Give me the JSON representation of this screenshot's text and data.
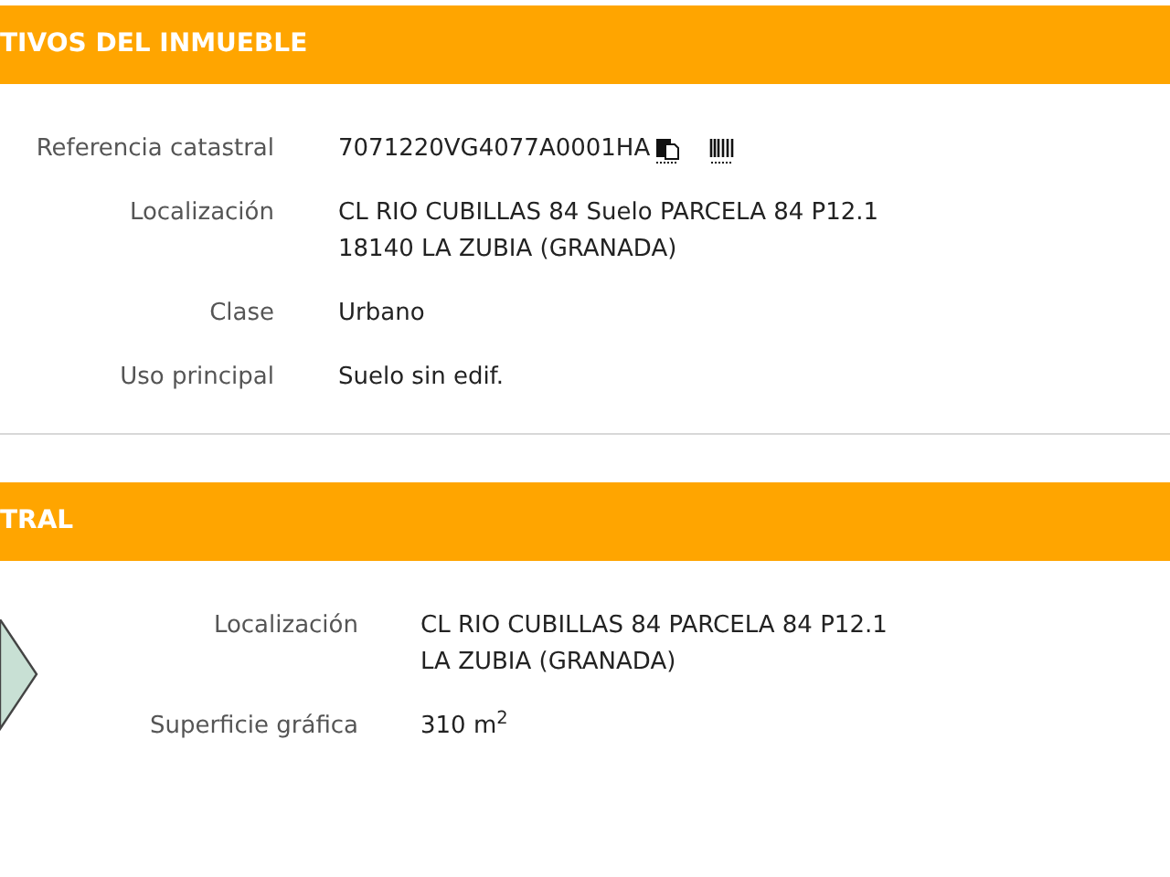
{
  "sections": [
    {
      "title": "TIVOS DEL INMUEBLE",
      "fields": [
        {
          "kind": "reference",
          "label": "Referencia catastral",
          "lines": [
            "7071220VG4077A0001HA"
          ]
        },
        {
          "kind": "text",
          "label": "Localización",
          "lines": [
            "CL RIO CUBILLAS 84 Suelo PARCELA 84 P12.1",
            "18140 LA ZUBIA (GRANADA)"
          ]
        },
        {
          "kind": "text",
          "label": "Clase",
          "lines": [
            "Urbano"
          ]
        },
        {
          "kind": "text",
          "label": "Uso principal",
          "lines": [
            "Suelo sin edif."
          ]
        }
      ]
    },
    {
      "title": "TRAL",
      "fields": [
        {
          "kind": "text",
          "label": "Localización",
          "lines": [
            "CL RIO CUBILLAS 84 PARCELA 84 P12.1",
            "LA ZUBIA (GRANADA)"
          ]
        },
        {
          "kind": "text",
          "label": "Superficie gráfica",
          "lines": [
            "310 m$^{2}$"
          ]
        }
      ]
    }
  ]
}
